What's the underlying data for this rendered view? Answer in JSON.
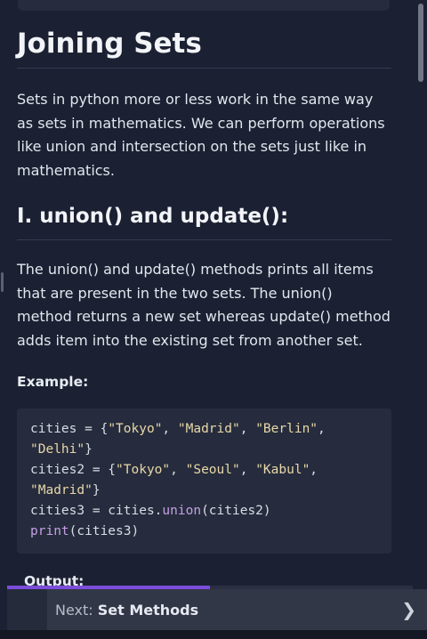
{
  "article": {
    "title": "Joining Sets",
    "intro": "Sets in python more or less work in the same way as sets in mathematics. We can perform operations like union and intersection on the sets just like in mathematics.",
    "section_title": "I. union() and update():",
    "section_text": "The union() and update() methods prints all items that are present in the two sets. The union() method returns a new set whereas update() method adds item into the existing set from another set.",
    "example_label": "Example:",
    "code": {
      "l1_a": "cities = {",
      "l1_s1": "\"Tokyo\"",
      "l1_s2": "\"Madrid\"",
      "l1_s3": "\"Berlin\"",
      "l2_s1": "\"Delhi\"",
      "l3_a": "cities2 = {",
      "l3_s1": "\"Tokyo\"",
      "l3_s2": "\"Seoul\"",
      "l3_s3": "\"Kabul\"",
      "l4_s1": "\"Madrid\"",
      "l5_a": "cities3 = cities.",
      "l5_fn": "union",
      "l5_b": "(cities2)",
      "l6_fn": "print",
      "l6_b": "(cities3)"
    },
    "output_label": "Output:"
  },
  "footer": {
    "next_prefix": "Next: ",
    "next_title": "Set Methods",
    "progress_fraction": 0.5
  },
  "colors": {
    "background": "#1b2132",
    "code_background": "#262c3d",
    "progress": "#7c4ddb",
    "string": "#e8d7a8",
    "function": "#c4a0e6"
  }
}
